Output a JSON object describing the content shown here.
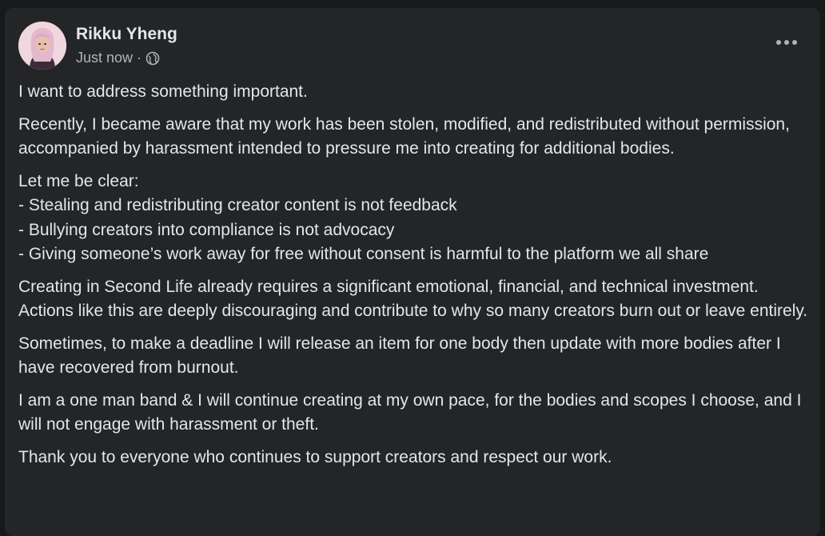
{
  "post": {
    "author": "Rikku Yheng",
    "timestamp": "Just now",
    "separator": "·",
    "privacy_icon": "globe-icon",
    "more_icon": "more-horizontal-icon",
    "paragraphs": {
      "p1": "I want to address something important.",
      "p2": "Recently, I became aware that my work has been stolen, modified, and redistributed without permission, accompanied by harassment intended to pressure me into creating for additional bodies.",
      "list_title": "Let me be clear:",
      "list_items": [
        "- Stealing and redistributing creator content is not feedback",
        "- Bullying creators into compliance is not advocacy",
        "- Giving someone’s work away for free without consent is harmful to the platform we all share"
      ],
      "p4": "Creating in Second Life already requires a significant emotional, financial, and technical investment. Actions like this are deeply discouraging and contribute to why so many creators burn out or leave entirely.",
      "p5": "Sometimes, to make a deadline I will release an item for one body then update with more bodies after I have recovered from burnout.",
      "p6": "I am a one man band & I will continue creating at my own pace, for the bodies and scopes I choose, and I will not engage with harassment or theft.",
      "p7": "Thank you to everyone who continues to support creators and respect our work."
    }
  },
  "colors": {
    "page_background": "#18191a",
    "card_background": "#242526",
    "primary_text": "#e4e6eb",
    "secondary_text": "#b0b3b8"
  }
}
